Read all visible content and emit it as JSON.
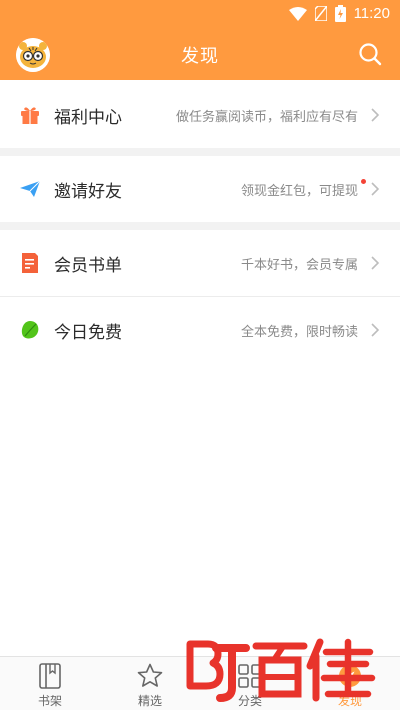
{
  "status": {
    "time": "11:20"
  },
  "header": {
    "title": "发现"
  },
  "menu": [
    {
      "label": "福利中心",
      "desc": "做任务赢阅读币，福利应有尽有",
      "icon": "gift-icon"
    },
    {
      "label": "邀请好友",
      "desc": "领现金红包，可提现",
      "icon": "paper-plane-icon"
    },
    {
      "label": "会员书单",
      "desc": "千本好书，会员专属",
      "icon": "booklist-icon"
    },
    {
      "label": "今日免费",
      "desc": "全本免费，限时畅读",
      "icon": "leaf-icon"
    }
  ],
  "tabs": [
    {
      "label": "书架",
      "icon": "bookshelf-icon"
    },
    {
      "label": "精选",
      "icon": "star-icon"
    },
    {
      "label": "分类",
      "icon": "category-icon"
    },
    {
      "label": "发现",
      "icon": "discover-icon"
    }
  ],
  "watermark": {
    "text": "BT百佳"
  },
  "colors": {
    "accent": "#ff9a3f",
    "gift": "#ff7a45",
    "invite": "#3aa0f3",
    "booklist": "#f4623a",
    "leaf": "#52c41a",
    "badge": "#f44336"
  }
}
